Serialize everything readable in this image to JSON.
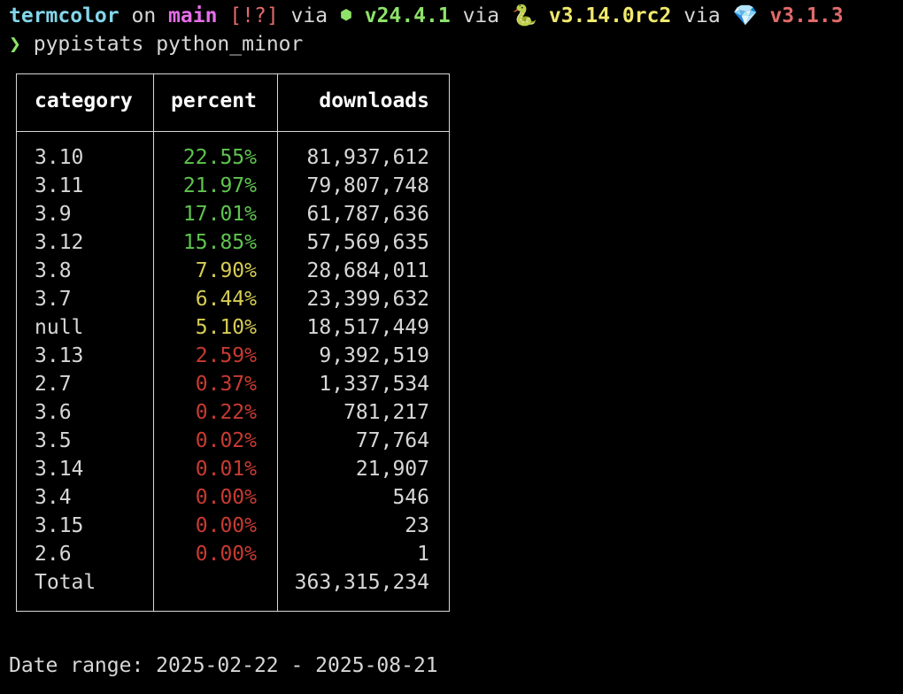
{
  "prompt": {
    "dir": "termcolor",
    "on": "on",
    "branch_icon": "",
    "branch": "main",
    "status": "[!?]",
    "via1": "via",
    "node_icon": "⬢",
    "node_version": "v24.4.1",
    "via2": "via",
    "python_icon": "🐍",
    "python_version": "v3.14.0rc2",
    "via3": "via",
    "ruby_icon": "💎",
    "ruby_version": "v3.1.3"
  },
  "command": {
    "arrow": "❯",
    "text": "pypistats python_minor"
  },
  "table": {
    "headers": {
      "category": "category",
      "percent": "percent",
      "downloads": "downloads"
    },
    "rows": [
      {
        "category": "3.10",
        "percent": "22.55%",
        "downloads": "81,937,612",
        "level": "green"
      },
      {
        "category": "3.11",
        "percent": "21.97%",
        "downloads": "79,807,748",
        "level": "green"
      },
      {
        "category": "3.9",
        "percent": "17.01%",
        "downloads": "61,787,636",
        "level": "green"
      },
      {
        "category": "3.12",
        "percent": "15.85%",
        "downloads": "57,569,635",
        "level": "green"
      },
      {
        "category": "3.8",
        "percent": "7.90%",
        "downloads": "28,684,011",
        "level": "yellow"
      },
      {
        "category": "3.7",
        "percent": "6.44%",
        "downloads": "23,399,632",
        "level": "yellow"
      },
      {
        "category": "null",
        "percent": "5.10%",
        "downloads": "18,517,449",
        "level": "yellow"
      },
      {
        "category": "3.13",
        "percent": "2.59%",
        "downloads": "9,392,519",
        "level": "red"
      },
      {
        "category": "2.7",
        "percent": "0.37%",
        "downloads": "1,337,534",
        "level": "red"
      },
      {
        "category": "3.6",
        "percent": "0.22%",
        "downloads": "781,217",
        "level": "red"
      },
      {
        "category": "3.5",
        "percent": "0.02%",
        "downloads": "77,764",
        "level": "red"
      },
      {
        "category": "3.14",
        "percent": "0.01%",
        "downloads": "21,907",
        "level": "red"
      },
      {
        "category": "3.4",
        "percent": "0.00%",
        "downloads": "546",
        "level": "red"
      },
      {
        "category": "3.15",
        "percent": "0.00%",
        "downloads": "23",
        "level": "red"
      },
      {
        "category": "2.6",
        "percent": "0.00%",
        "downloads": "1",
        "level": "red"
      },
      {
        "category": "Total",
        "percent": "",
        "downloads": "363,315,234",
        "level": "none"
      }
    ]
  },
  "footer": {
    "date_range": "Date range: 2025-02-22 - 2025-08-21"
  },
  "colors": {
    "background": "#000000",
    "text": "#d7d7d7",
    "dir": "#84d6ea",
    "branch": "#e66ee9",
    "status": "#e26a6a",
    "node": "#8ee26a",
    "python": "#f1e96c",
    "ruby": "#e26a6a",
    "pct_green": "#5fc44f",
    "pct_yellow": "#d6cc54",
    "pct_red": "#c83a32"
  }
}
